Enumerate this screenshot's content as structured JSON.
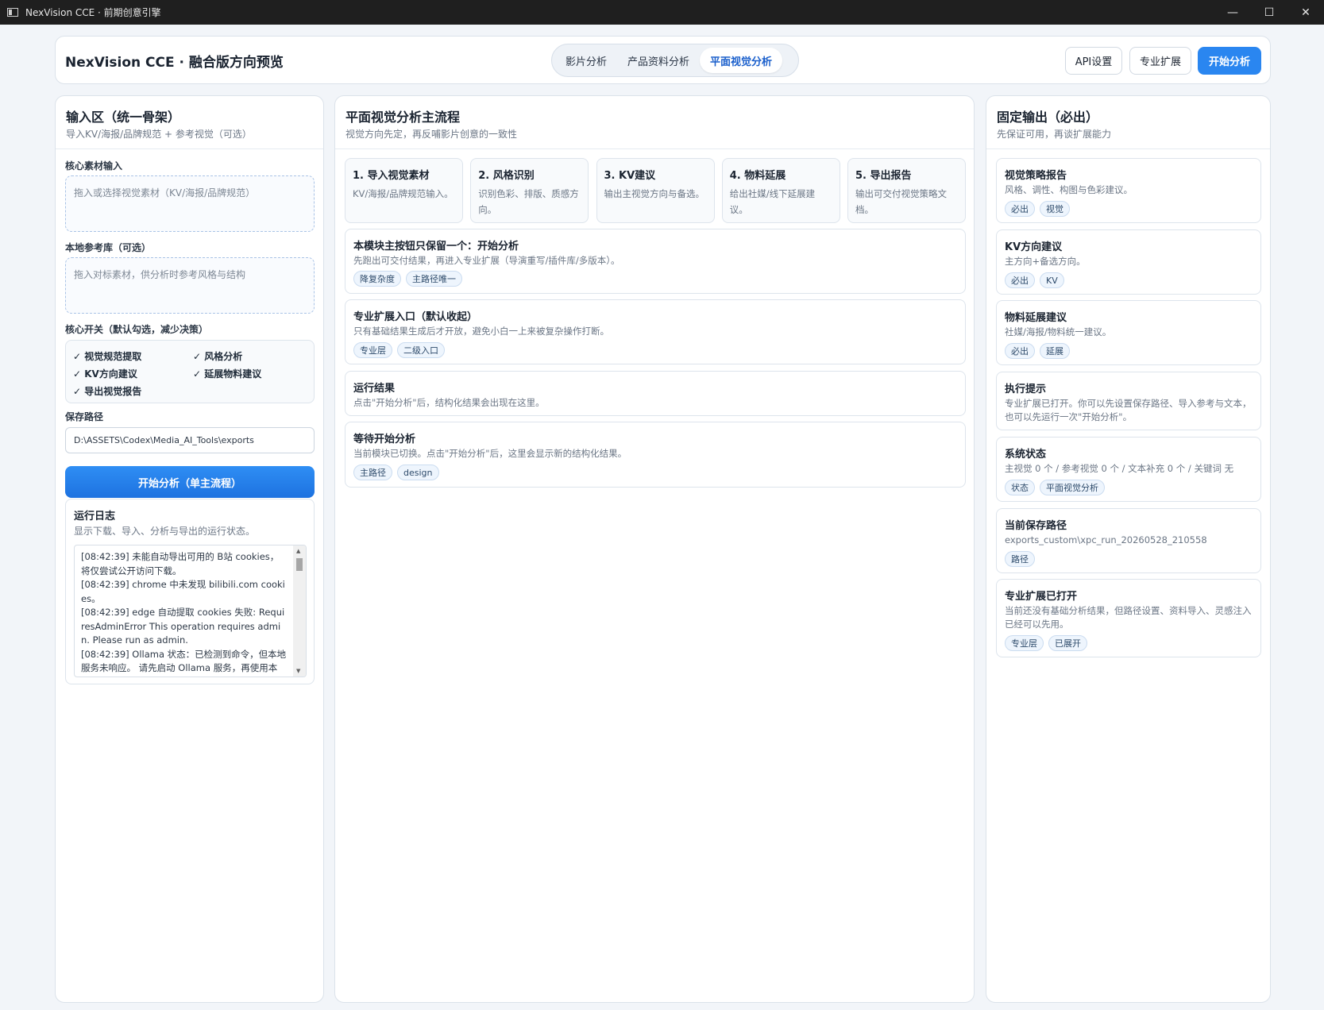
{
  "window": {
    "title": "NexVision CCE · 前期创意引擎",
    "controls": {
      "minimize": "—",
      "maximize": "☐",
      "close": "✕"
    }
  },
  "header": {
    "app_title": "NexVision CCE · 融合版方向预览",
    "tabs": [
      {
        "label": "影片分析",
        "active": false
      },
      {
        "label": "产品资料分析",
        "active": false
      },
      {
        "label": "平面视觉分析",
        "active": true
      }
    ],
    "api_settings": "API设置",
    "pro_extend": "专业扩展",
    "start": "开始分析"
  },
  "left": {
    "title": "输入区（统一骨架）",
    "subtitle": "导入KV/海报/品牌规范 + 参考视觉（可选）",
    "core_input_label": "核心素材输入",
    "core_input_placeholder": "拖入或选择视觉素材（KV/海报/品牌规范）",
    "reference_label": "本地参考库（可选）",
    "reference_placeholder": "拖入对标素材，供分析时参考风格与结构",
    "switches_label": "核心开关（默认勾选，减少决策）",
    "switches": [
      "✓ 视觉规范提取",
      "✓ 风格分析",
      "✓ KV方向建议",
      "✓ 延展物料建议",
      "✓ 导出视觉报告"
    ],
    "save_path_label": "保存路径",
    "save_path_value": "D:\\ASSETS\\Codex\\Media_AI_Tools\\exports",
    "start_button": "开始分析（单主流程）",
    "log": {
      "title": "运行日志",
      "subtitle": "显示下载、导入、分析与导出的运行状态。",
      "text": "[08:42:39] 未能自动导出可用的 B站 cookies，将仅尝试公开访问下载。\n[08:42:39] chrome 中未发现 bilibili.com cookies。\n[08:42:39] edge 自动提取 cookies 失败: RequiresAdminError This operation requires admin. Please run as admin.\n[08:42:39] Ollama 状态：已检测到命令，但本地服务未响应。 请先启动 Ollama 服务，再使用本"
    }
  },
  "middle": {
    "title": "平面视觉分析主流程",
    "subtitle": "视觉方向先定，再反哺影片创意的一致性",
    "steps": [
      {
        "title": "1. 导入视觉素材",
        "desc": "KV/海报/品牌规范输入。"
      },
      {
        "title": "2. 风格识别",
        "desc": "识别色彩、排版、质感方向。"
      },
      {
        "title": "3. KV建议",
        "desc": "输出主视觉方向与备选。"
      },
      {
        "title": "4. 物料延展",
        "desc": "给出社媒/线下延展建议。"
      },
      {
        "title": "5. 导出报告",
        "desc": "输出可交付视觉策略文档。"
      }
    ],
    "cards": [
      {
        "title": "本模块主按钮只保留一个：开始分析",
        "desc": "先跑出可交付结果，再进入专业扩展（导演重写/插件库/多版本）。",
        "tags": [
          "降复杂度",
          "主路径唯一"
        ]
      },
      {
        "title": "专业扩展入口（默认收起）",
        "desc": "只有基础结果生成后才开放，避免小白一上来被复杂操作打断。",
        "tags": [
          "专业层",
          "二级入口"
        ]
      },
      {
        "title": "运行结果",
        "desc": "点击\"开始分析\"后，结构化结果会出现在这里。",
        "tags": []
      },
      {
        "title": "等待开始分析",
        "desc": "当前模块已切换。点击\"开始分析\"后，这里会显示新的结构化结果。",
        "tags": [
          "主路径",
          "design"
        ]
      }
    ]
  },
  "right": {
    "title": "固定输出（必出）",
    "subtitle": "先保证可用，再谈扩展能力",
    "cards": [
      {
        "title": "视觉策略报告",
        "desc": "风格、调性、构图与色彩建议。",
        "tags": [
          "必出",
          "视觉"
        ]
      },
      {
        "title": "KV方向建议",
        "desc": "主方向+备选方向。",
        "tags": [
          "必出",
          "KV"
        ]
      },
      {
        "title": "物料延展建议",
        "desc": "社媒/海报/物料统一建议。",
        "tags": [
          "必出",
          "延展"
        ]
      },
      {
        "title": "执行提示",
        "desc": "专业扩展已打开。你可以先设置保存路径、导入参考与文本，也可以先运行一次\"开始分析\"。",
        "tags": []
      },
      {
        "title": "系统状态",
        "desc": "主视觉 0 个 / 参考视觉 0 个 / 文本补充 0 个 / 关键词 无",
        "tags": [
          "状态",
          "平面视觉分析"
        ]
      },
      {
        "title": "当前保存路径",
        "desc": "exports_custom\\xpc_run_20260528_210558",
        "tags": [
          "路径"
        ]
      },
      {
        "title": "专业扩展已打开",
        "desc": "当前还没有基础分析结果，但路径设置、资料导入、灵感注入已经可以先用。",
        "tags": [
          "专业层",
          "已展开"
        ]
      }
    ]
  }
}
